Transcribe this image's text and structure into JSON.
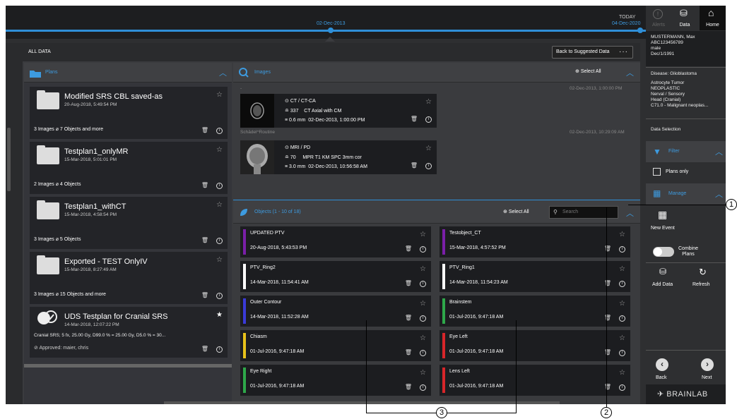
{
  "timeline": {
    "date_left": "02-Dec-2013",
    "today_label": "TODAY",
    "today_date": "04-Dec-2020"
  },
  "header": {
    "title": "ALL DATA",
    "back_button": "Back to Suggested Data",
    "more": "···"
  },
  "plans": {
    "title": "Plans",
    "items": [
      {
        "name": "Modified SRS CBL saved-as",
        "date": "20-Aug-2018, 5:49:54 PM",
        "stats": "3 Images  ⌀ 7 Objects and more"
      },
      {
        "name": "Testplan1_onlyMR",
        "date": "15-Mar-2018, 5:01:01 PM",
        "stats": "2 Images  ⌀ 4 Objects"
      },
      {
        "name": "Testplan1_withCT",
        "date": "15-Mar-2018, 4:58:54 PM",
        "stats": "3 Images  ⌀ 5 Objects"
      },
      {
        "name": "Exported - TEST OnlyIV",
        "date": "15-Mar-2018, 8:27:49 AM",
        "stats": "3 Images  ⌀ 15 Objects and more"
      },
      {
        "name": "UDS Testplan for Cranial SRS",
        "date": "14-Mar-2018, 12:07:22 PM",
        "desc": "Cranial SRS; 5 fx, 25.00 Gy, D99.0 % = 25.00 Gy, D5.0 % = 30...",
        "approved": "Approved:  maier, chris"
      }
    ]
  },
  "images": {
    "title": "Images",
    "select_all": "Select All",
    "groups": [
      {
        "series": "-",
        "date": "02-Dec-2013, 1:00:00 PM",
        "modality": "CT / CT-CA",
        "count": "337",
        "desc": "CT Axial with CM",
        "thickness": "0.6 mm",
        "acq": "02-Dec-2013, 1:00:00 PM"
      },
      {
        "series": "Schädel^Routine",
        "date": "02-Dec-2013, 10:29:09 AM",
        "modality": "MRI / PD",
        "count": "70",
        "desc": "MPR T1 KM SPC 3mm cor",
        "thickness": "3.0 mm",
        "acq": "02-Dec-2013, 10:56:58 AM"
      }
    ]
  },
  "objects": {
    "title": "Objects (1 - 10 of 18)",
    "select_all": "Select All",
    "search_placeholder": "Search",
    "items": [
      {
        "name": "UPDATED PTV",
        "date": "20-Aug-2018, 5:43:53 PM",
        "color": "#7a1fa8"
      },
      {
        "name": "Testobject_CT",
        "date": "15-Mar-2018, 4:57:52 PM",
        "color": "#7a1fa8"
      },
      {
        "name": "PTV_Ring2",
        "date": "14-Mar-2018, 11:54:41 AM",
        "color": "#ffffff"
      },
      {
        "name": "PTV_Ring1",
        "date": "14-Mar-2018, 11:54:23 AM",
        "color": "#ffffff"
      },
      {
        "name": "Outer Contour",
        "date": "14-Mar-2018, 11:52:28 AM",
        "color": "#3a3ad8"
      },
      {
        "name": "Brainstem",
        "date": "01-Jul-2016, 9:47:18 AM",
        "color": "#2ea84a"
      },
      {
        "name": "Chiasm",
        "date": "01-Jul-2016, 9:47:18 AM",
        "color": "#e8c21a"
      },
      {
        "name": "Eye Left",
        "date": "01-Jul-2016, 9:47:18 AM",
        "color": "#d8262a"
      },
      {
        "name": "Eye Right",
        "date": "01-Jul-2016, 9:47:18 AM",
        "color": "#2ea84a"
      },
      {
        "name": "Lens Left",
        "date": "01-Jul-2016, 9:47:18 AM",
        "color": "#d8262a"
      }
    ]
  },
  "topnav": {
    "alerts": "Alerts",
    "data": "Data",
    "home": "Home"
  },
  "patient": {
    "name": "MUSTERMANN, Max",
    "id": "ABC123456789",
    "sex": "male",
    "dob": "Dec/1/1991"
  },
  "disease": {
    "line1": "Disease:  Glioblastoma",
    "line2": "Astrocyte Tumor",
    "line3": "NEOPLASTIC",
    "line4": "Nerval / Sensory",
    "line5": "Head (Cranial)",
    "line6": "C71.0 - Malignant neoplas..."
  },
  "sidebar": {
    "data_selection": "Data Selection",
    "filter": "Filter",
    "plans_only": "Plans only",
    "manage": "Manage",
    "new_event": "New Event",
    "combine": "Combine",
    "plans": "Plans",
    "add_data": "Add Data",
    "refresh": "Refresh",
    "back": "Back",
    "next": "Next",
    "brand": "BRAINLAB"
  },
  "callouts": {
    "c1": "1",
    "c2": "2",
    "c3": "3"
  },
  "colors": {
    "accent": "#3d9be0",
    "bg": "#3a3b3e"
  }
}
